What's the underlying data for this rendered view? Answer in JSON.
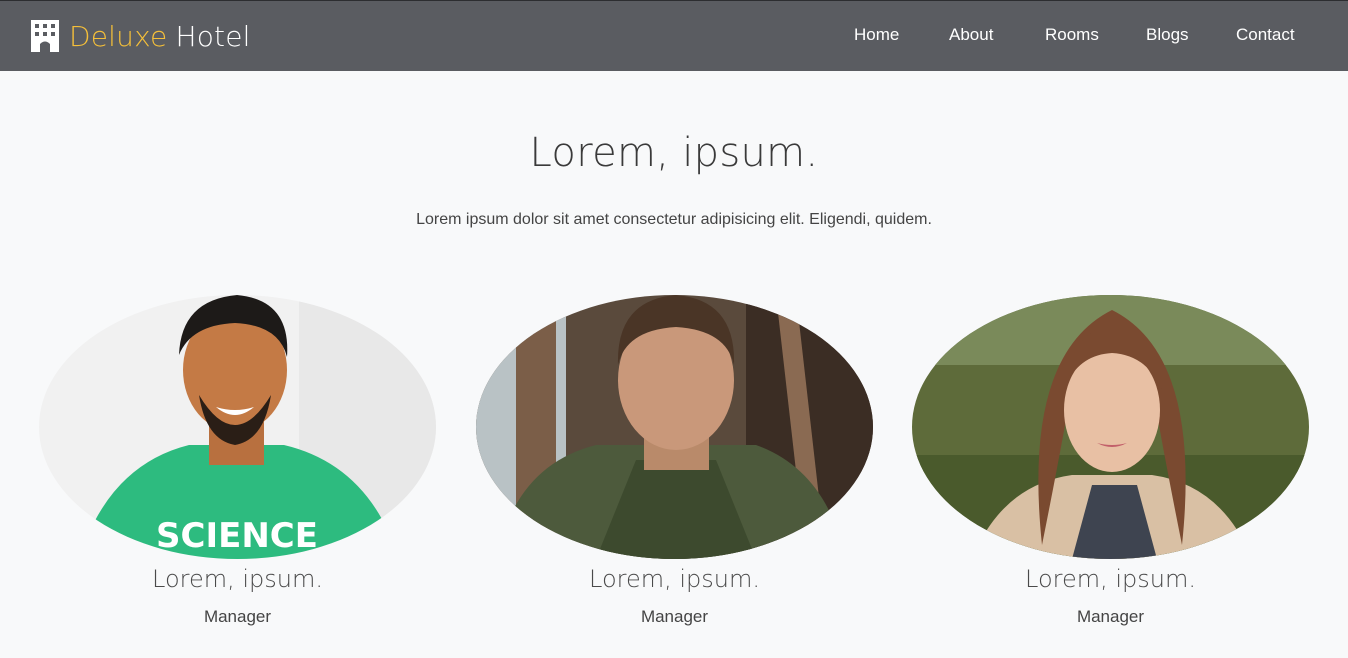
{
  "brand": {
    "icon": "hotel-building-icon",
    "accent": "Deluxe",
    "rest": "Hotel",
    "accent_color": "#f4bf3a"
  },
  "nav": {
    "home": "Home",
    "about": "About",
    "rooms": "Rooms",
    "blogs": "Blogs",
    "contact": "Contact"
  },
  "hero": {
    "title": "Lorem, ipsum.",
    "subtitle": "Lorem ipsum dolor sit amet consectetur adipisicing elit. Eligendi, quidem."
  },
  "team": [
    {
      "name": "Lorem, ipsum.",
      "role": "Manager",
      "shirt_text": "SCIENCE"
    },
    {
      "name": "Lorem, ipsum.",
      "role": "Manager"
    },
    {
      "name": "Lorem, ipsum.",
      "role": "Manager"
    }
  ],
  "colors": {
    "navbar": "#5a5c61",
    "background": "#f8f9fa"
  }
}
